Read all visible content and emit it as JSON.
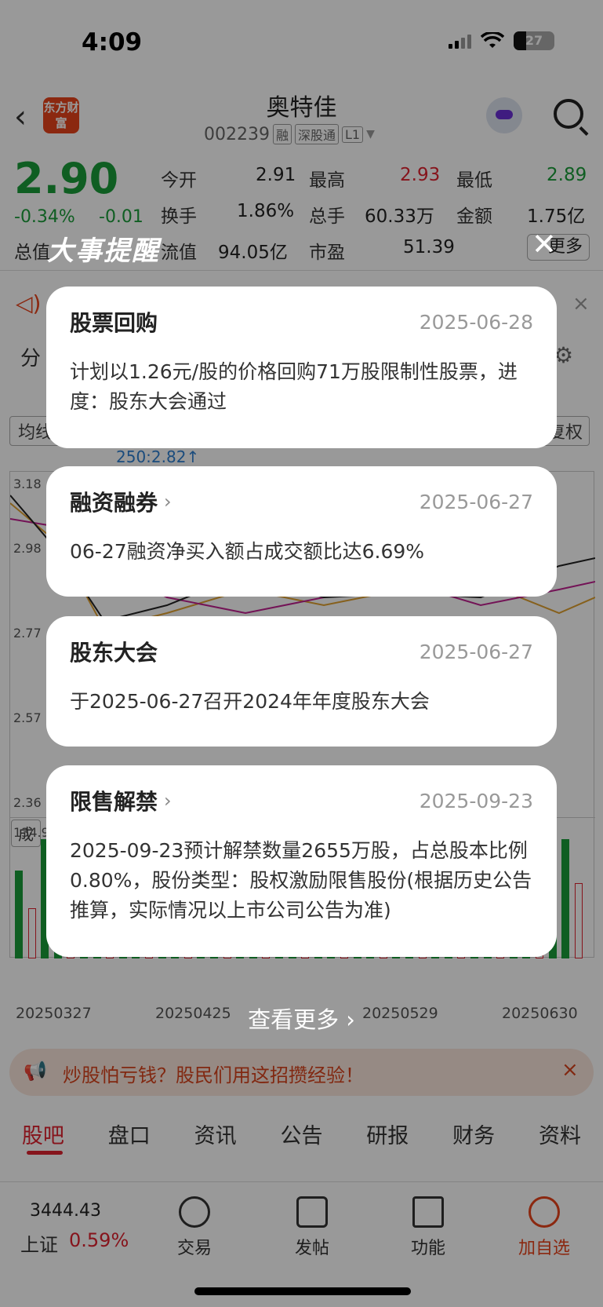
{
  "status": {
    "time": "4:09",
    "battery": "27"
  },
  "header": {
    "logo": "东方财富",
    "name": "奥特佳",
    "code": "002239",
    "tags": [
      "融",
      "深股通",
      "L1"
    ]
  },
  "quote": {
    "price": "2.90",
    "pct": "-0.34%",
    "chg": "-0.01",
    "r1": [
      [
        "今开",
        "2.91"
      ],
      [
        "最高",
        "2.93"
      ],
      [
        "最低",
        "2.89"
      ]
    ],
    "r2": [
      [
        "换手",
        "1.86%"
      ],
      [
        "总手",
        "60.33万"
      ],
      [
        "金额",
        "1.75亿"
      ]
    ],
    "r3_pre": "总值",
    "r3": [
      [
        "流值",
        "94.05亿"
      ],
      [
        "市盈",
        "51.39"
      ]
    ],
    "more": "更多"
  },
  "chart": {
    "buttons": [
      "分",
      "均线",
      "复权"
    ],
    "tip": "250:2.82↑",
    "y_labels": [
      "3.18",
      "2.98",
      "2.77",
      "2.57",
      "2.36"
    ],
    "vol_label": "134.9",
    "vol_btn": "成",
    "dates": [
      "20250327",
      "20250425",
      "20250529",
      "20250630"
    ]
  },
  "ad": {
    "text": "炒股怕亏钱？股民们用这招攒经验！"
  },
  "tabs": [
    "股吧",
    "盘口",
    "资讯",
    "公告",
    "研报",
    "财务",
    "资料"
  ],
  "bottom_nav": {
    "index_value": "3444.43",
    "index_name": "上证",
    "index_pct": "0.59%",
    "items": [
      "交易",
      "发帖",
      "功能",
      "加自选"
    ]
  },
  "modal": {
    "title": "大事提醒",
    "close": "✕",
    "see_more": "查看更多 ›",
    "cards": [
      {
        "title": "股票回购",
        "date": "2025-06-28",
        "body": "计划以1.26元/股的价格回购71万股限制性股票，进度：股东大会通过"
      },
      {
        "title": "融资融券",
        "date": "2025-06-27",
        "body": "06-27融资净买入额占成交额比达6.69%"
      },
      {
        "title": "股东大会",
        "date": "2025-06-27",
        "body": "于2025-06-27召开2024年年度股东大会"
      },
      {
        "title": "限售解禁",
        "date": "2025-09-23",
        "body": "2025-09-23预计解禁数量2655万股，占总股本比例0.80%，股份类型：股权激励限售股份(根据历史公告推算，实际情况以上市公司公告为准)"
      }
    ]
  }
}
